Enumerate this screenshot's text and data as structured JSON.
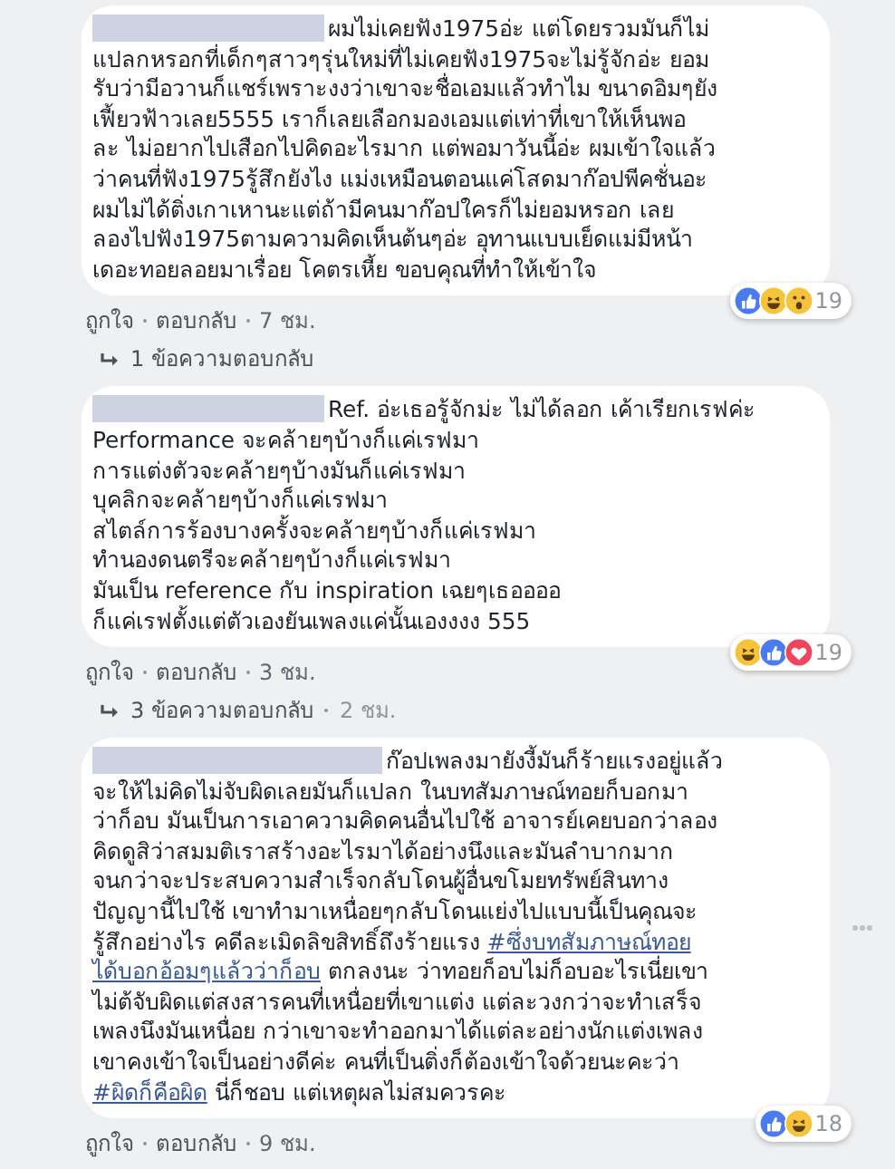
{
  "comments": [
    {
      "author": {
        "redacted": true
      },
      "menu_visible": false,
      "segments": [
        {
          "kind": "text",
          "text": "ผมไม่เคยฟัง1975อ่ะ แต่โดยรวมมันก็ไม่\nแปลกหรอกที่เด็กๆสาวๆรุ่นใหม่ที่ไม่เคยฟัง1975จะไม่รู้จักอ่ะ ยอม\nรับว่ามีอวานก็แชร์เพราะงงว่าเขาจะชื่อเอมแล้วทำไม ขนาดอิมๆยัง\nเฟี้ยวฟ้าวเลย5555 เราก็เลยเลือกมองเอมแต่เท่าที่เขาให้เห็นพอ\nละ ไม่อยากไปเสือกไปคิดอะไรมาก แต่พอมาวันนี้อ่ะ ผมเข้าใจแล้ว\nว่าคนที่ฟัง1975รู้สึกยังไง แม่งเหมือนตอนแค่โสดมาก๊อปพีคชั่นอะ\nผมไม่ได้ติ่งเกาเหานะแต่ถ้ามีคนมาก๊อปใครก็ไม่ยอมหรอก เลย\nลองไปฟัง1975ตามความคิดเห็นต้นๆอ่ะ อุทานแบบเย็ดแม่มีหน้า\nเดอะทอยลอยมาเรื่อย โคตรเหี้ย ขอบคุณที่ทำให้เข้าใจ"
        }
      ],
      "reactions": {
        "icons": [
          {
            "kind": "like"
          },
          {
            "kind": "haha"
          },
          {
            "kind": "wow"
          }
        ],
        "count": "19"
      },
      "actions": [
        "ถูกใจ",
        "ตอบกลับ"
      ],
      "time": "7 ชม.",
      "replies": {
        "label": "1 ข้อความตอบกลับ"
      }
    },
    {
      "author": {
        "redacted": true
      },
      "menu_visible": false,
      "segments": [
        {
          "kind": "text",
          "text": "Ref. อ่ะเธอรู้จักม่ะ ไม่ได้ลอก เค้าเรียกเรฟค่ะ\nPerformance จะคล้ายๆบ้างก็แค่เรฟมา\nการแต่งตัวจะคล้ายๆบ้างมันก็แค่เรฟมา\nบุคลิกจะคล้ายๆบ้างก็แค่เรฟมา\nสไตล์การร้องบางครั้งจะคล้ายๆบ้างก็แค่เรฟมา\nทำนองดนตรีจะคล้ายๆบ้างก็แค่เรฟมา\nมันเป็น reference กับ inspiration เฉยๆเธออออ\nก็แค่เรฟตั้งแต่ตัวเองยันเพลงแค่นั้นเองงงง 555"
        }
      ],
      "reactions": {
        "icons": [
          {
            "kind": "haha"
          },
          {
            "kind": "like"
          },
          {
            "kind": "love"
          }
        ],
        "count": "19"
      },
      "actions": [
        "ถูกใจ",
        "ตอบกลับ"
      ],
      "time": "3 ชม.",
      "replies": {
        "label": "3 ข้อความตอบกลับ",
        "time": "2 ชม."
      }
    },
    {
      "author": {
        "redacted": true
      },
      "menu_visible": true,
      "segments": [
        {
          "kind": "text",
          "text": "ก๊อปเพลงมายังงี้มันก็ร้ายแรงอยู่แล้ว\nจะให้ไม่คิดไม่จับผิดเลยมันก็แปลก ในบทสัมภาษณ์ทอยก็บอกมา\nว่าก็อบ มันเป็นการเอาความคิดคนอื่นไปใช้ อาจารย์เคยบอกว่าลอง\nคิดดูสิว่าสมมติเราสร้างอะไรมาได้อย่างนึงและมันลำบากมาก\nจนกว่าจะประสบความสำเร็จกลับโดนผู้อื่นขโมยทรัพย์สินทาง\nปัญญานี้ไปใช้ เขาทำมาเหนื่อยๆกลับโดนแย่งไปแบบนี้เป็นคุณจะ\nรู้สึกอย่างไร คดีละเมิดลิขสิทธิ์ถึงร้ายแรง "
        },
        {
          "kind": "hashtag",
          "text": "#ซึ่งบทสัมภาษณ์ทอย"
        },
        {
          "kind": "break"
        },
        {
          "kind": "hashtag",
          "text": "ได้บอกอ้อมๆแล้วว่าก็อบ"
        },
        {
          "kind": "text",
          "text": " ตกลงนะ ว่าทอยก็อบไม่ก็อบอะไรเนี่ยเขา\nไม่ต้จับผิดแต่สงสารคนที่เหนื่อยที่เขาแต่ง แต่ละวงกว่าจะทำเสร็จ\nเพลงนึงมันเหนื่อย กว่าเขาจะทำออกมาได้แต่ละอย่างนักแต่งเพลง\nเขาคงเข้าใจเป็นอย่างดีค่ะ คนที่เป็นติ่งก็ต้องเข้าใจด้วยนะคะว่า\n"
        },
        {
          "kind": "hashtag",
          "text": "#ผิดก็คือผิด"
        },
        {
          "kind": "text",
          "text": " นี่ก็ชอบ แต่เหตุผลไม่สมควรคะ"
        }
      ],
      "reactions": {
        "icons": [
          {
            "kind": "like"
          },
          {
            "kind": "haha"
          }
        ],
        "count": "18"
      },
      "actions": [
        "ถูกใจ",
        "ตอบกลับ"
      ],
      "time": "9 ชม."
    }
  ]
}
